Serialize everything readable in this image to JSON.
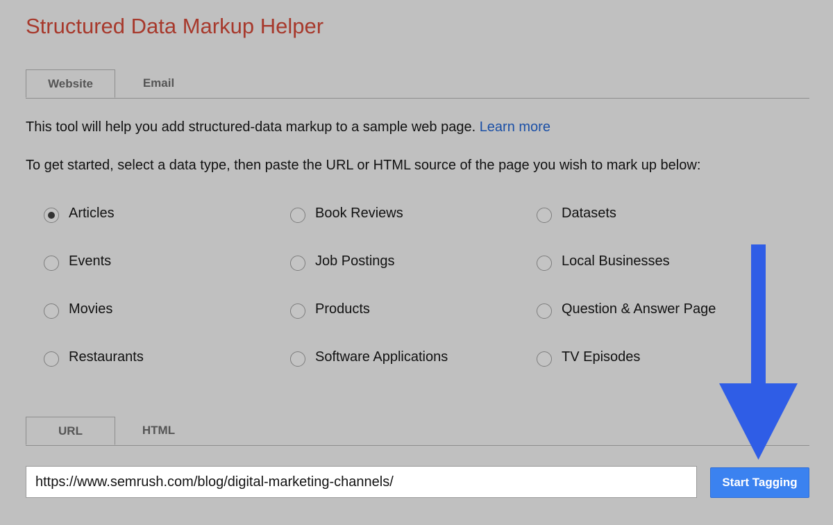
{
  "page": {
    "title": "Structured Data Markup Helper"
  },
  "source_tabs": {
    "website": "Website",
    "email": "Email"
  },
  "intro": {
    "text": "This tool will help you add structured-data markup to a sample web page. ",
    "link": "Learn more"
  },
  "instructions": "To get started, select a data type, then paste the URL or HTML source of the page you wish to mark up below:",
  "data_types": [
    {
      "label": "Articles",
      "checked": true
    },
    {
      "label": "Book Reviews",
      "checked": false
    },
    {
      "label": "Datasets",
      "checked": false
    },
    {
      "label": "Events",
      "checked": false
    },
    {
      "label": "Job Postings",
      "checked": false
    },
    {
      "label": "Local Businesses",
      "checked": false
    },
    {
      "label": "Movies",
      "checked": false
    },
    {
      "label": "Products",
      "checked": false
    },
    {
      "label": "Question & Answer Page",
      "checked": false
    },
    {
      "label": "Restaurants",
      "checked": false
    },
    {
      "label": "Software Applications",
      "checked": false
    },
    {
      "label": "TV Episodes",
      "checked": false
    }
  ],
  "input_tabs": {
    "url": "URL",
    "html": "HTML"
  },
  "url_field": {
    "value": "https://www.semrush.com/blog/digital-marketing-channels/"
  },
  "start_button": "Start Tagging",
  "annotation": {
    "arrow_color": "#2f5de6",
    "icon": "down-arrow-icon"
  },
  "colors": {
    "background": "#c0c0c0",
    "title": "#a7392c",
    "link": "#1a4fa6",
    "button": "#3b82f0"
  }
}
